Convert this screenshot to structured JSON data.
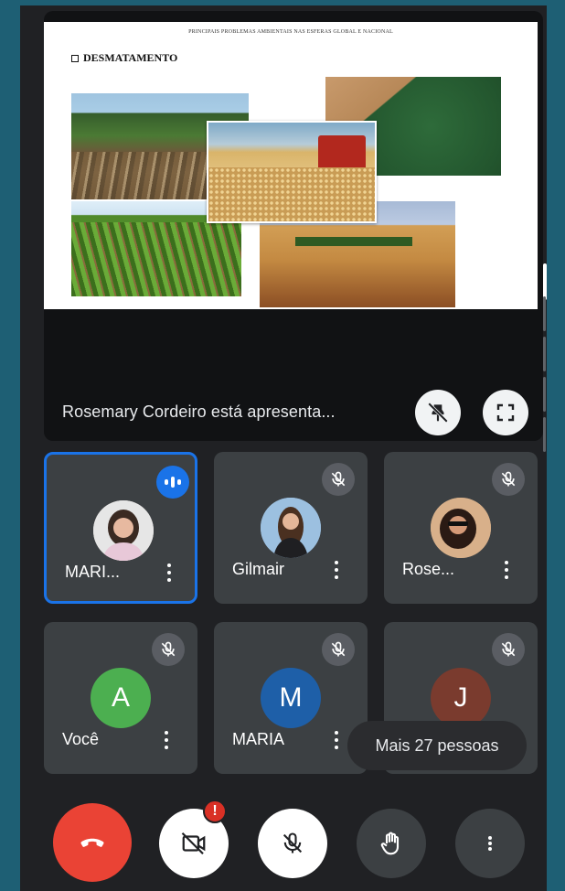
{
  "presentation": {
    "slide_header": "PRINCIPAIS PROBLEMAS AMBIENTAIS NAS ESFERAS GLOBAL E NACIONAL",
    "slide_title": "DESMATAMENTO",
    "presenter_text": "Rosemary Cordeiro está apresenta...",
    "pin_icon": "pin-off-icon",
    "fullscreen_icon": "fullscreen-icon"
  },
  "participants": [
    {
      "name": "MARI...",
      "status": "speaking",
      "avatar_type": "photo"
    },
    {
      "name": "Gilmair",
      "status": "muted",
      "avatar_type": "photo"
    },
    {
      "name": "Rose...",
      "status": "muted",
      "avatar_type": "photo"
    },
    {
      "name": "Você",
      "status": "muted",
      "avatar_type": "initial",
      "initial": "A",
      "color": "#4caf50"
    },
    {
      "name": "MARIA",
      "status": "muted",
      "avatar_type": "initial",
      "initial": "M",
      "color": "#1e5fa8"
    },
    {
      "name": "",
      "status": "muted",
      "avatar_type": "initial",
      "initial": "J",
      "color": "#7a3b2e"
    }
  ],
  "more_people": "Mais 27 pessoas",
  "controls": {
    "end_call_icon": "phone-hangup-icon",
    "camera_icon": "camera-off-icon",
    "camera_alert": "!",
    "mic_icon": "mic-off-icon",
    "hand_icon": "raise-hand-icon",
    "more_icon": "more-vertical-icon"
  },
  "colors": {
    "background": "#1e5f74",
    "surface": "#202124",
    "tile": "#3c4043",
    "active_border": "#1a73e8",
    "end_call": "#ea4335"
  }
}
